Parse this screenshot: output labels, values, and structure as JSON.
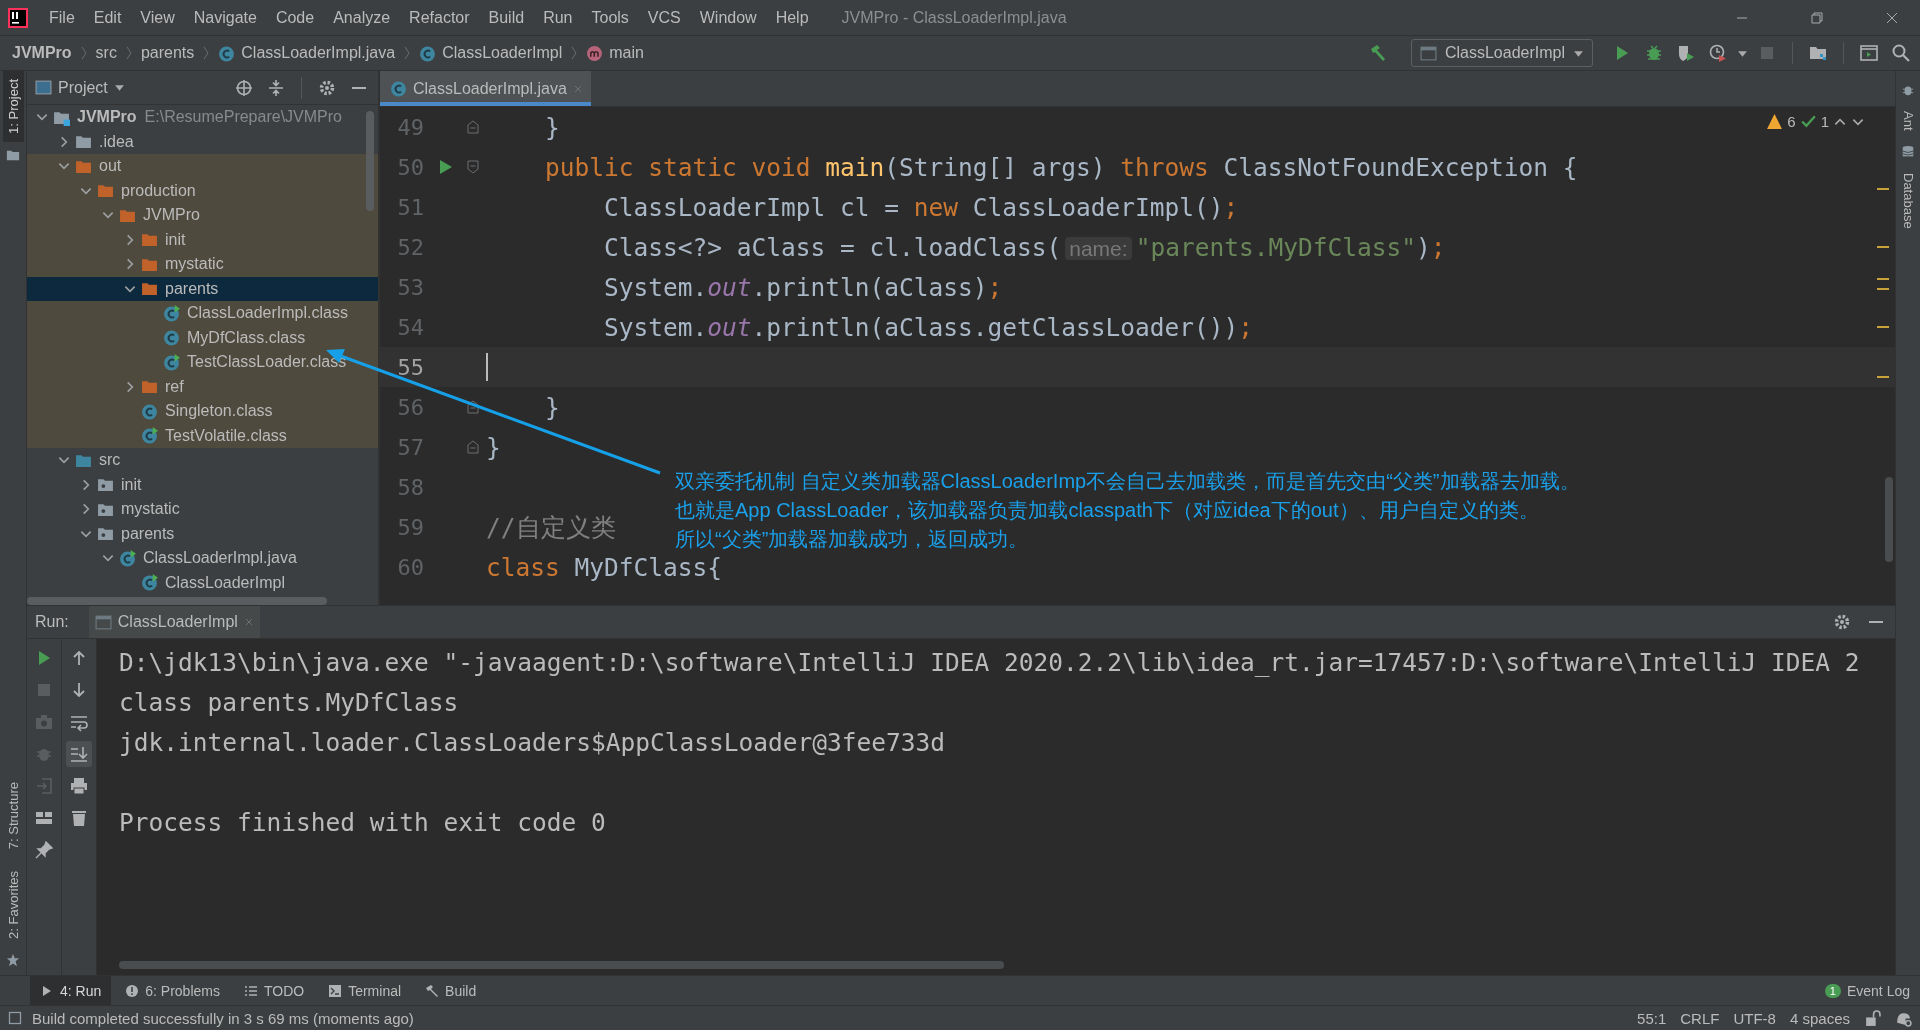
{
  "menu": [
    "File",
    "Edit",
    "View",
    "Navigate",
    "Code",
    "Analyze",
    "Refactor",
    "Build",
    "Run",
    "Tools",
    "VCS",
    "Window",
    "Help"
  ],
  "window": {
    "title": "JVMPro - ClassLoaderImpl.java"
  },
  "breadcrumbs": [
    {
      "label": "JVMPro",
      "kind": "project"
    },
    {
      "label": "src",
      "kind": "folder"
    },
    {
      "label": "parents",
      "kind": "folder"
    },
    {
      "label": "ClassLoaderImpl.java",
      "kind": "class"
    },
    {
      "label": "ClassLoaderImpl",
      "kind": "class"
    },
    {
      "label": "main",
      "kind": "method"
    }
  ],
  "run_config": {
    "label": "ClassLoaderImpl"
  },
  "tool_stripes": {
    "left_top": [
      {
        "label": "1: Project",
        "selected": true
      }
    ],
    "left_bottom": [
      {
        "label": "7: Structure",
        "selected": false
      },
      {
        "label": "2: Favorites",
        "selected": false
      }
    ],
    "right": [
      {
        "label": "Ant",
        "selected": false
      },
      {
        "label": "Database",
        "selected": false
      }
    ]
  },
  "project_panel": {
    "title": "Project",
    "tree": [
      {
        "label": "JVMPro",
        "kind": "module",
        "path": "E:\\ResumePrepare\\JVMPro",
        "expanded": true,
        "selected": false,
        "children": [
          {
            "label": ".idea",
            "kind": "folder",
            "expanded": false,
            "selected": false
          },
          {
            "label": "out",
            "kind": "excluded-folder",
            "expanded": true,
            "selected": false,
            "children": [
              {
                "label": "production",
                "kind": "excluded-folder",
                "expanded": true,
                "selected": false,
                "children": [
                  {
                    "label": "JVMPro",
                    "kind": "excluded-folder",
                    "expanded": true,
                    "selected": false,
                    "children": [
                      {
                        "label": "init",
                        "kind": "excluded-folder",
                        "expanded": false,
                        "selected": false
                      },
                      {
                        "label": "mystatic",
                        "kind": "excluded-folder",
                        "expanded": false,
                        "selected": false
                      },
                      {
                        "label": "parents",
                        "kind": "excluded-folder",
                        "expanded": true,
                        "selected": true,
                        "children": [
                          {
                            "label": "ClassLoaderImpl.class",
                            "kind": "class",
                            "runnable": true,
                            "selected": false
                          },
                          {
                            "label": "MyDfClass.class",
                            "kind": "class",
                            "runnable": false,
                            "selected": false
                          },
                          {
                            "label": "TestClassLoader.class",
                            "kind": "class",
                            "runnable": true,
                            "selected": false
                          }
                        ]
                      },
                      {
                        "label": "ref",
                        "kind": "excluded-folder",
                        "expanded": false,
                        "selected": false
                      },
                      {
                        "label": "Singleton.class",
                        "kind": "class",
                        "runnable": false,
                        "selected": false
                      },
                      {
                        "label": "TestVolatile.class",
                        "kind": "class",
                        "runnable": true,
                        "selected": false
                      }
                    ]
                  }
                ]
              }
            ]
          },
          {
            "label": "src",
            "kind": "source-root",
            "expanded": true,
            "selected": false,
            "children": [
              {
                "label": "init",
                "kind": "package",
                "expanded": false,
                "selected": false
              },
              {
                "label": "mystatic",
                "kind": "package",
                "expanded": false,
                "selected": false
              },
              {
                "label": "parents",
                "kind": "package",
                "expanded": true,
                "selected": false,
                "children": [
                  {
                    "label": "ClassLoaderImpl.java",
                    "kind": "class",
                    "runnable": true,
                    "expanded": true,
                    "selected": false,
                    "children": [
                      {
                        "label": "ClassLoaderImpl",
                        "kind": "class",
                        "runnable": true,
                        "selected": false
                      }
                    ]
                  }
                ]
              }
            ]
          }
        ]
      }
    ]
  },
  "editor": {
    "tabs": [
      {
        "label": "ClassLoaderImpl.java",
        "selected": true
      }
    ],
    "warnings": "6",
    "passed": "1",
    "lines": [
      {
        "number": "49",
        "runnable": false,
        "current": false,
        "fold_start": false,
        "fold_end": true,
        "tokens": [
          {
            "kind": "plain",
            "text": "    }"
          }
        ]
      },
      {
        "number": "50",
        "runnable": true,
        "current": false,
        "fold_start": true,
        "fold_end": false,
        "tokens": [
          {
            "kind": "keyword",
            "text": "    public static void "
          },
          {
            "kind": "method",
            "text": "main"
          },
          {
            "kind": "plain",
            "text": "(String[] args) "
          },
          {
            "kind": "keyword",
            "text": "throws"
          },
          {
            "kind": "plain",
            "text": " ClassNotFoundException {"
          }
        ]
      },
      {
        "number": "51",
        "runnable": false,
        "current": false,
        "fold_start": false,
        "fold_end": false,
        "tokens": [
          {
            "kind": "plain",
            "text": "        ClassLoaderImpl cl = "
          },
          {
            "kind": "keyword",
            "text": "new"
          },
          {
            "kind": "plain",
            "text": " ClassLoaderImpl()"
          },
          {
            "kind": "keyword",
            "text": ";"
          }
        ]
      },
      {
        "number": "52",
        "runnable": false,
        "current": false,
        "fold_start": false,
        "fold_end": false,
        "tokens": [
          {
            "kind": "plain",
            "text": "        Class<?> aClass = cl.loadClass("
          },
          {
            "kind": "hint",
            "text": "name:"
          },
          {
            "kind": "string",
            "text": "\"parents.MyDfClass\""
          },
          {
            "kind": "plain",
            "text": ")"
          },
          {
            "kind": "keyword",
            "text": ";"
          }
        ]
      },
      {
        "number": "53",
        "runnable": false,
        "current": false,
        "fold_start": false,
        "fold_end": false,
        "tokens": [
          {
            "kind": "plain",
            "text": "        System."
          },
          {
            "kind": "field",
            "text": "out"
          },
          {
            "kind": "plain",
            "text": ".println(aClass)"
          },
          {
            "kind": "keyword",
            "text": ";"
          }
        ]
      },
      {
        "number": "54",
        "runnable": false,
        "current": false,
        "fold_start": false,
        "fold_end": false,
        "tokens": [
          {
            "kind": "plain",
            "text": "        System."
          },
          {
            "kind": "field",
            "text": "out"
          },
          {
            "kind": "plain",
            "text": ".println(aClass.getClassLoader())"
          },
          {
            "kind": "keyword",
            "text": ";"
          }
        ]
      },
      {
        "number": "55",
        "runnable": false,
        "current": true,
        "fold_start": false,
        "fold_end": false
      },
      {
        "number": "56",
        "runnable": false,
        "current": false,
        "fold_start": false,
        "fold_end": true,
        "tokens": [
          {
            "kind": "plain",
            "text": "    }"
          }
        ]
      },
      {
        "number": "57",
        "runnable": false,
        "current": false,
        "fold_start": false,
        "fold_end": true,
        "tokens": [
          {
            "kind": "plain",
            "text": "}"
          }
        ]
      },
      {
        "number": "58",
        "runnable": false,
        "current": false,
        "fold_start": false,
        "fold_end": false
      },
      {
        "number": "59",
        "runnable": false,
        "current": false,
        "fold_start": false,
        "fold_end": false,
        "tokens": [
          {
            "kind": "comment",
            "text": "//自定义类"
          }
        ]
      },
      {
        "number": "60",
        "runnable": false,
        "current": false,
        "fold_start": false,
        "fold_end": false,
        "tokens": [
          {
            "kind": "keyword",
            "text": "class"
          },
          {
            "kind": "plain",
            "text": " MyDfClass{"
          }
        ]
      }
    ],
    "annotation": {
      "lines": [
        "双亲委托机制 自定义类加载器ClassLoaderImp不会自己去加载类，而是首先交由“父类”加载器去加载。",
        "也就是App ClassLoader，该加载器负责加载classpath下（对应idea下的out）、用户自定义的类。",
        "所以“父类”加载器加载成功，返回成功。"
      ]
    }
  },
  "run_panel": {
    "label": "Run:",
    "tabs": [
      {
        "label": "ClassLoaderImpl"
      }
    ],
    "console": [
      "D:\\jdk13\\bin\\java.exe \"-javaagent:D:\\software\\IntelliJ IDEA 2020.2.2\\lib\\idea_rt.jar=17457:D:\\software\\IntelliJ IDEA 2",
      "class parents.MyDfClass",
      "jdk.internal.loader.ClassLoaders$AppClassLoader@3fee733d"
    ],
    "exit_message": "Process finished with exit code 0"
  },
  "bottom_tools": [
    {
      "label": "4: Run",
      "kind": "run",
      "selected": true
    },
    {
      "label": "6: Problems",
      "kind": "problems",
      "selected": false
    },
    {
      "label": "TODO",
      "kind": "todo",
      "selected": false
    },
    {
      "label": "Terminal",
      "kind": "terminal",
      "selected": false
    },
    {
      "label": "Build",
      "kind": "build",
      "selected": false
    }
  ],
  "event_log": {
    "label": "Event Log",
    "count": "1"
  },
  "status_bar": {
    "message": "Build completed successfully in 3 s 69 ms (moments ago)",
    "items": [
      "55:1",
      "CRLF",
      "UTF-8",
      "4 spaces"
    ]
  }
}
